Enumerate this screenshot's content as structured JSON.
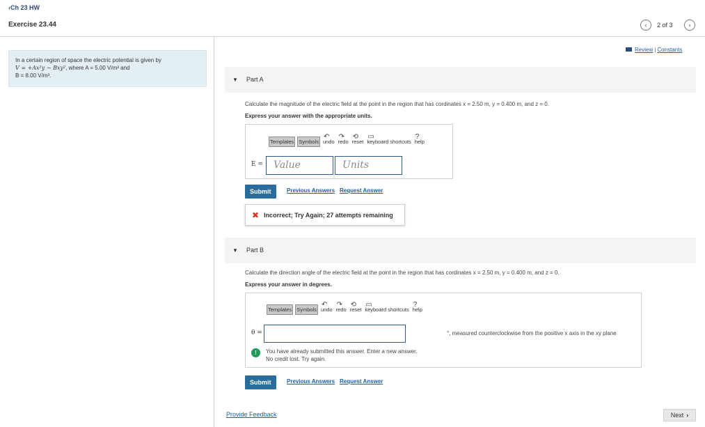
{
  "header": {
    "back_link": "Ch 23 HW",
    "exercise_title": "Exercise 23.44",
    "page_indicator": "2 of 3"
  },
  "review": {
    "review_label": "Review",
    "constants_label": "Constants"
  },
  "problem": {
    "line1": "In a certain region of space the electric potential is given by",
    "equation": "V = +Ax²y − Bxy²",
    "where_a": ", where A = 5.00 V/m³ and",
    "b_value": "B = 8.00 V/m³."
  },
  "part_a": {
    "label": "Part A",
    "question": "Calculate the magnitude of the electric field at the point in the region that has cordinates x = 2.50 m, y = 0.400 m, and z = 0.",
    "instruction": "Express your answer with the appropriate units.",
    "toolbar": [
      "Templates",
      "Symbols",
      "undo",
      "redo",
      "reset",
      "keyboard shortcuts",
      "help"
    ],
    "var_label": "E =",
    "value_placeholder": "Value",
    "units_placeholder": "Units",
    "submit": "Submit",
    "previous_answers": "Previous Answers",
    "request_answer": "Request Answer",
    "feedback": "Incorrect; Try Again; 27 attempts remaining"
  },
  "part_b": {
    "label": "Part B",
    "question": "Calculate the direction angle of the electric field at the point in the region that has cordinates x = 2.50 m, y = 0.400 m, and z = 0.",
    "instruction": "Express your answer in degrees.",
    "toolbar": [
      "Templates",
      "Symbols",
      "undo",
      "redo",
      "reset",
      "keyboard shortcuts",
      "help"
    ],
    "var_label": "θ =",
    "unit_hint": "°, measured counterclockwise from the positive x axis in the xy plane",
    "info_line1": "You have already submitted this answer. Enter a new answer.",
    "info_line2": "No credit lost. Try again.",
    "submit": "Submit",
    "previous_answers": "Previous Answers",
    "request_answer": "Request Answer"
  },
  "footer": {
    "provide_feedback": "Provide Feedback",
    "next": "Next"
  },
  "colors": {
    "accent": "#2a6d9c",
    "link": "#1a5fa8",
    "problem_bg": "#e4eef5",
    "error": "#d3342b",
    "info": "#1f9a5b"
  },
  "icons": [
    "chevron-left-icon",
    "chevron-right-icon",
    "book-icon",
    "triangle-down-icon",
    "undo-icon",
    "redo-icon",
    "reset-icon",
    "keyboard-icon",
    "help-icon",
    "x-icon",
    "info-icon"
  ]
}
